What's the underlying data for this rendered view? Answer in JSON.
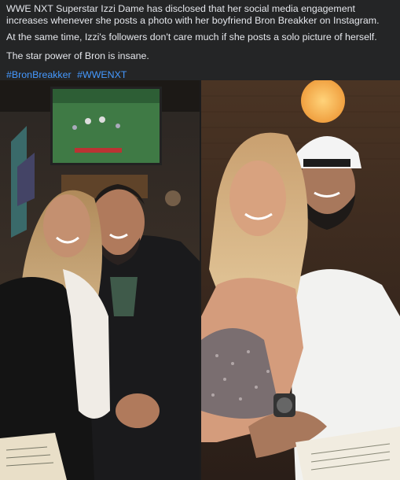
{
  "post": {
    "paragraphs": [
      "WWE NXT Superstar Izzi Dame has disclosed that her social media engagement increases whenever she posts a photo with her boyfriend Bron Breakker on Instagram.",
      "At the same time, Izzi's followers don't care much if she posts a solo picture of herself.",
      "The star power of Bron is insane."
    ],
    "hashtags": [
      "#BronBreakker",
      "#WWENXT"
    ]
  },
  "photos": [
    {
      "name": "left-photo"
    },
    {
      "name": "right-photo"
    }
  ],
  "colors": {
    "background": "#242526",
    "text": "#e4e6eb",
    "hashtag": "#4599ff"
  }
}
